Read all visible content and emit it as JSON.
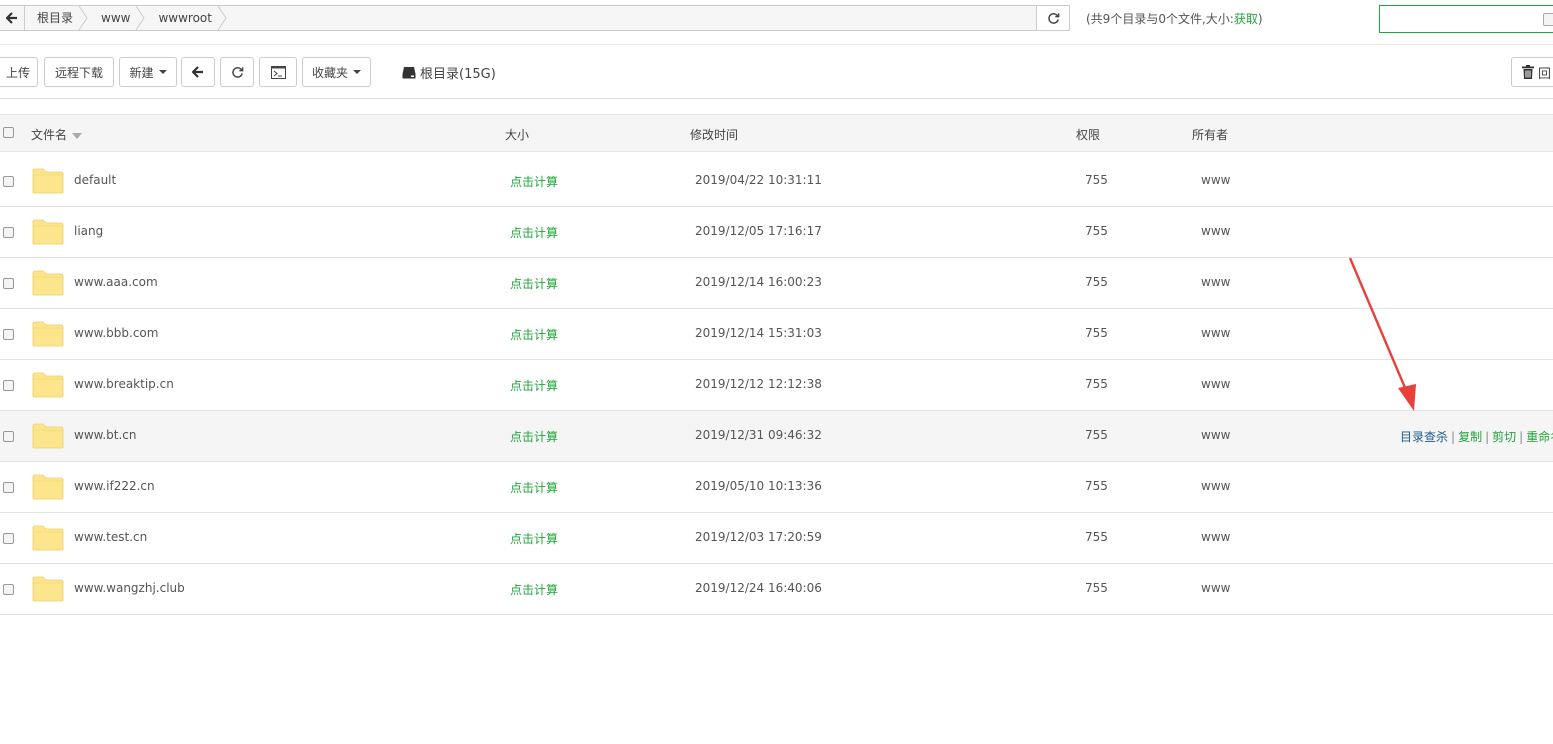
{
  "path": {
    "crumbs": [
      "根目录",
      "www",
      "wwwroot"
    ],
    "summary_text": "(共9个目录与0个文件,大小:",
    "summary_link": "获取",
    "summary_end": ")"
  },
  "toolbar": {
    "upload": "上传",
    "remote_download": "远程下载",
    "new": "新建",
    "favorites": "收藏夹",
    "disk_label": "根目录(15G)",
    "recycle_bin": "回"
  },
  "table": {
    "columns": {
      "name": "文件名",
      "size": "大小",
      "mtime": "修改时间",
      "perm": "权限",
      "owner": "所有者"
    },
    "rows": [
      {
        "name": "default",
        "size": "点击计算",
        "mtime": "2019/04/22 10:31:11",
        "perm": "755",
        "owner": "www"
      },
      {
        "name": "liang",
        "size": "点击计算",
        "mtime": "2019/12/05 17:16:17",
        "perm": "755",
        "owner": "www"
      },
      {
        "name": "www.aaa.com",
        "size": "点击计算",
        "mtime": "2019/12/14 16:00:23",
        "perm": "755",
        "owner": "www"
      },
      {
        "name": "www.bbb.com",
        "size": "点击计算",
        "mtime": "2019/12/14 15:31:03",
        "perm": "755",
        "owner": "www"
      },
      {
        "name": "www.breaktip.cn",
        "size": "点击计算",
        "mtime": "2019/12/12 12:12:38",
        "perm": "755",
        "owner": "www"
      },
      {
        "name": "www.bt.cn",
        "size": "点击计算",
        "mtime": "2019/12/31 09:46:32",
        "perm": "755",
        "owner": "www"
      },
      {
        "name": "www.if222.cn",
        "size": "点击计算",
        "mtime": "2019/05/10 10:13:36",
        "perm": "755",
        "owner": "www"
      },
      {
        "name": "www.test.cn",
        "size": "点击计算",
        "mtime": "2019/12/03 17:20:59",
        "perm": "755",
        "owner": "www"
      },
      {
        "name": "www.wangzhj.club",
        "size": "点击计算",
        "mtime": "2019/12/24 16:40:06",
        "perm": "755",
        "owner": "www"
      }
    ],
    "hover_row_ops": [
      "目录查杀",
      "复制",
      "剪切",
      "重命名"
    ]
  },
  "colors": {
    "accent": "#20a53a",
    "link_blue": "#1e5b8c",
    "arrow": "#e8403a",
    "folder": "#fde58c"
  }
}
